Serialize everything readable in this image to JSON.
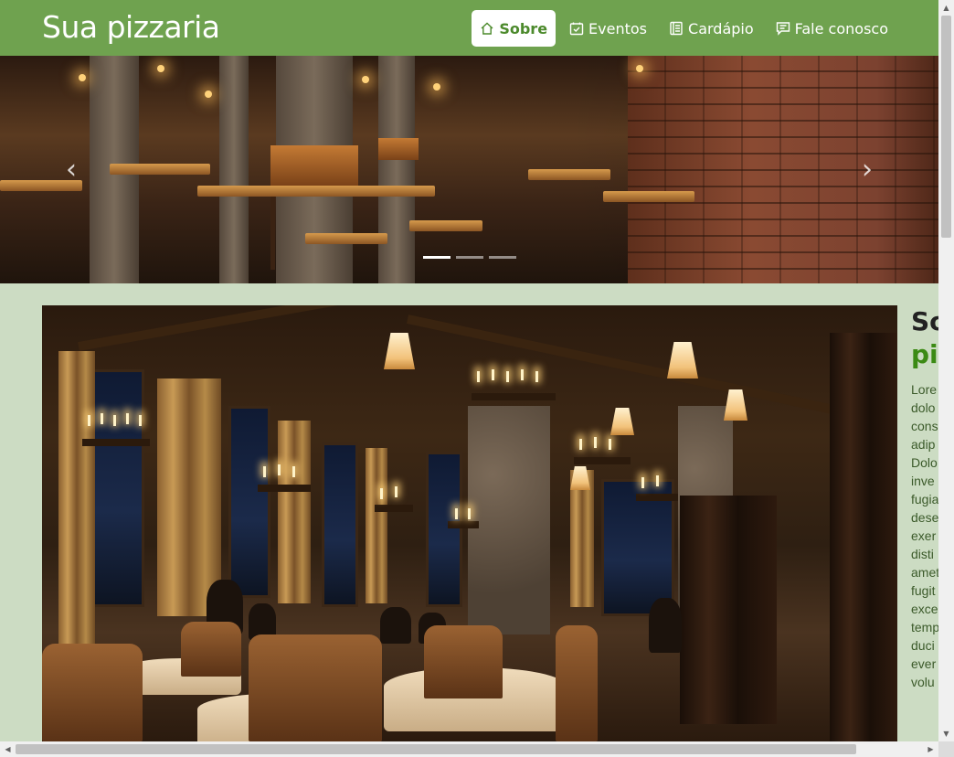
{
  "brand": {
    "title": "Sua pizzaria"
  },
  "nav": {
    "items": [
      {
        "label": "Sobre",
        "icon": "home-icon",
        "active": true
      },
      {
        "label": "Eventos",
        "icon": "calendar-check-icon",
        "active": false
      },
      {
        "label": "Cardápio",
        "icon": "journal-icon",
        "active": false
      },
      {
        "label": "Fale conosco",
        "icon": "chat-icon",
        "active": false
      }
    ]
  },
  "carousel": {
    "prev_symbol": "‹",
    "next_symbol": "›",
    "slide_count": 3,
    "active_slide": 1
  },
  "about": {
    "title_part1": "So",
    "title_part2": "pi",
    "text_lines": [
      "Lore",
      "dolo",
      "cons",
      "adip",
      "Dolo",
      "inve",
      "fugia",
      "dese",
      "exer",
      "disti",
      "amet",
      "fugit",
      "exce",
      "temp",
      "duci",
      "ever",
      "volu"
    ]
  },
  "scrollbars": {
    "up": "▲",
    "down": "▼",
    "left": "◀",
    "right": "▶"
  },
  "colors": {
    "navbar": "#6fa24f",
    "page_bg": "#ccdcc3",
    "accent_green": "#3b8a14"
  }
}
